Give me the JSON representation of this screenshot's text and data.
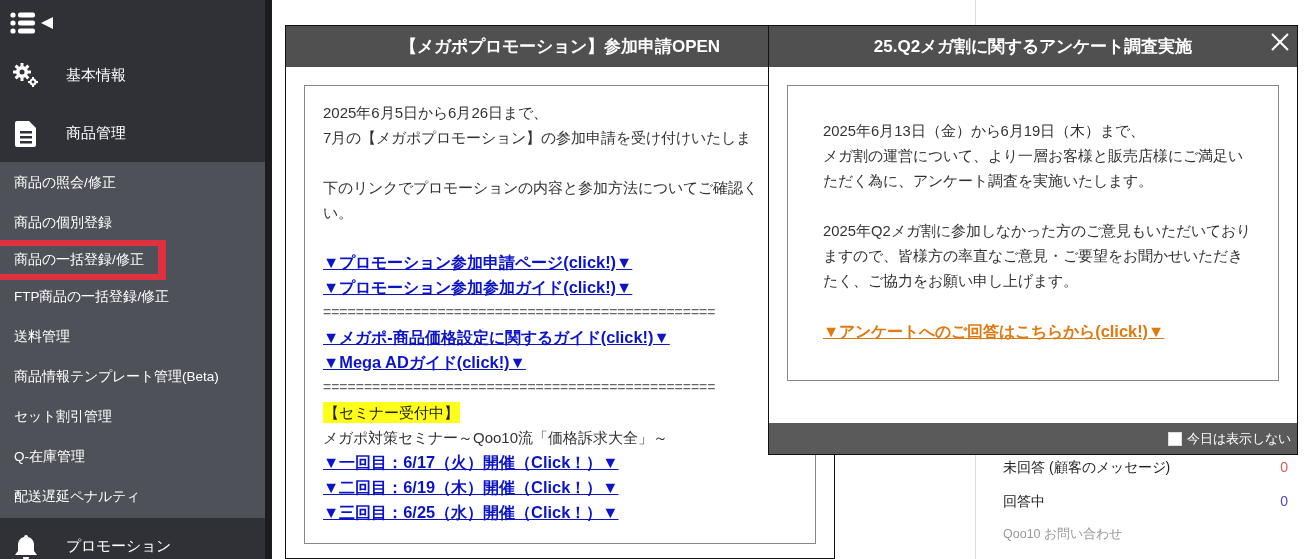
{
  "sidebar": {
    "sections": [
      {
        "label": "基本情報",
        "kind": "settings",
        "expanded": false
      },
      {
        "label": "商品管理",
        "kind": "document",
        "expanded": true,
        "items": [
          {
            "label": "商品の照会/修正",
            "selected": false
          },
          {
            "label": "商品の個別登録",
            "selected": false
          },
          {
            "label": "商品の一括登録/修正",
            "selected": true
          },
          {
            "label": "FTP商品の一括登録/修正",
            "selected": false
          },
          {
            "label": "送料管理",
            "selected": false
          },
          {
            "label": "商品情報テンプレート管理(Beta)",
            "selected": false
          },
          {
            "label": "セット割引管理",
            "selected": false
          },
          {
            "label": "Q-在庫管理",
            "selected": false
          },
          {
            "label": "配送遅延ペナルティ",
            "selected": false
          }
        ]
      },
      {
        "label": "プロモーション",
        "kind": "bell",
        "expanded": false
      }
    ]
  },
  "inquiries": {
    "rows": [
      {
        "label": "未回答 (顧客のメッセージ)",
        "count": "0",
        "color": "#e0584f"
      },
      {
        "label": "回答中",
        "count": "0",
        "color": "#4a4ac4"
      }
    ],
    "footer": "Qoo10 お問い合わせ"
  },
  "popups": [
    {
      "title": "【メガポプロモーション】参加申請OPEN",
      "kind": "promotion",
      "closable": false,
      "lines": [
        {
          "kind": "text",
          "text": "2025年6月5日から6月26日まで、"
        },
        {
          "kind": "text",
          "text": "7月の【メガポプロモーション】の参加申請を受け付けいたしま"
        },
        {
          "kind": "blank"
        },
        {
          "kind": "text",
          "text": "下のリンクでプロモーションの内容と参加方法についてご確認く"
        },
        {
          "kind": "text",
          "text": "い。"
        },
        {
          "kind": "blank"
        },
        {
          "kind": "link",
          "text": "▼プロモーション参加申請ページ(click!)▼"
        },
        {
          "kind": "link",
          "text": "▼プロモーション参加参加ガイド(click!)▼"
        },
        {
          "kind": "rule",
          "text": "================================================"
        },
        {
          "kind": "link",
          "text": "▼メガポ-商品価格設定に関するガイド(click!)▼"
        },
        {
          "kind": "link",
          "text": "▼Mega ADガイド(click!)▼"
        },
        {
          "kind": "rule",
          "text": "================================================"
        },
        {
          "kind": "highlight",
          "text": "【セミナー受付中】"
        },
        {
          "kind": "text",
          "text": "メガポ対策セミナー～Qoo10流「価格訴求大全」～"
        },
        {
          "kind": "link",
          "text": "▼一回目：6/17（火）開催（Click！）▼"
        },
        {
          "kind": "link",
          "text": "▼二回目：6/19（木）開催（Click！）▼"
        },
        {
          "kind": "link",
          "text": "▼三回目：6/25（水）開催（Click！）▼"
        }
      ]
    },
    {
      "title": "25.Q2メガ割に関するアンケート調査実施",
      "kind": "survey",
      "closable": true,
      "lines": [
        {
          "kind": "blank"
        },
        {
          "kind": "text",
          "text": "2025年6月13日（金）から6月19日（木）まで、"
        },
        {
          "kind": "text",
          "text": "メガ割の運営について、より一層お客様と販売店様にご満足いただく為に、アンケート調査を実施いたします。"
        },
        {
          "kind": "blank"
        },
        {
          "kind": "text",
          "text": "2025年Q2メガ割に参加しなかった方のご意見もいただいておりますので、皆様方の率直なご意見・ご要望をお聞かせいただきたく、ご協力をお願い申し上げます。"
        },
        {
          "kind": "blank"
        },
        {
          "kind": "link",
          "text": "▼アンケートへのご回答はこちらから(click!)▼"
        },
        {
          "kind": "blank"
        }
      ],
      "footer": {
        "label": "今日は表示しない",
        "checked": false
      }
    }
  ]
}
